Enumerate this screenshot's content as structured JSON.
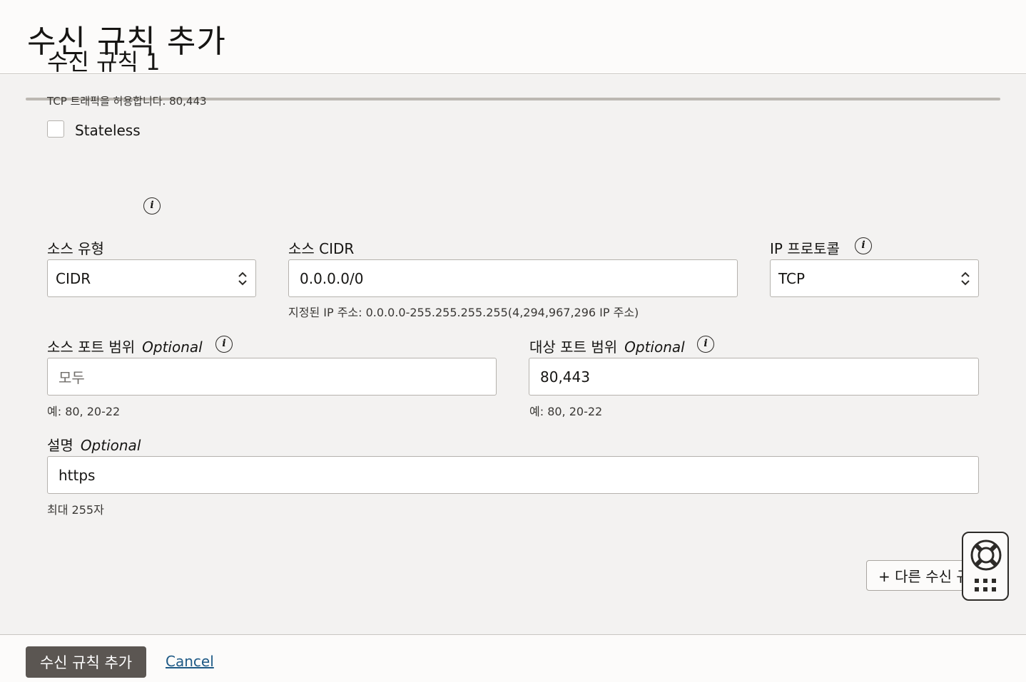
{
  "header": {
    "title": "수신 규칙 추가"
  },
  "rule": {
    "title": "수신 규칙 1",
    "summary": "TCP 트래픽을 허용합니다. 80,443",
    "stateless_label": "Stateless",
    "stateless_checked": false
  },
  "source_type": {
    "label": "소스 유형",
    "value": "CIDR"
  },
  "source_cidr": {
    "label": "소스 CIDR",
    "value": "0.0.0.0/0",
    "hint": "지정된 IP 주소: 0.0.0.0-255.255.255.255(4,294,967,296 IP 주소)"
  },
  "ip_protocol": {
    "label": "IP 프로토콜",
    "value": "TCP"
  },
  "source_port": {
    "label": "소스 포트 범위",
    "optional": "Optional",
    "placeholder": "모두",
    "hint": "예: 80, 20-22"
  },
  "dest_port": {
    "label": "대상 포트 범위",
    "optional": "Optional",
    "value": "80,443",
    "hint": "예: 80, 20-22"
  },
  "description": {
    "label": "설명",
    "optional": "Optional",
    "value": "https",
    "hint": "최대 255자"
  },
  "add_another": {
    "label": "+ 다른 수신 규칙"
  },
  "footer": {
    "submit_label": "수신 규칙 추가",
    "cancel_label": "Cancel"
  },
  "icons": {
    "info": "info-icon",
    "help": "lifebuoy-icon",
    "apps": "grid-dots-icon",
    "select": "updown-chevron-icon"
  }
}
